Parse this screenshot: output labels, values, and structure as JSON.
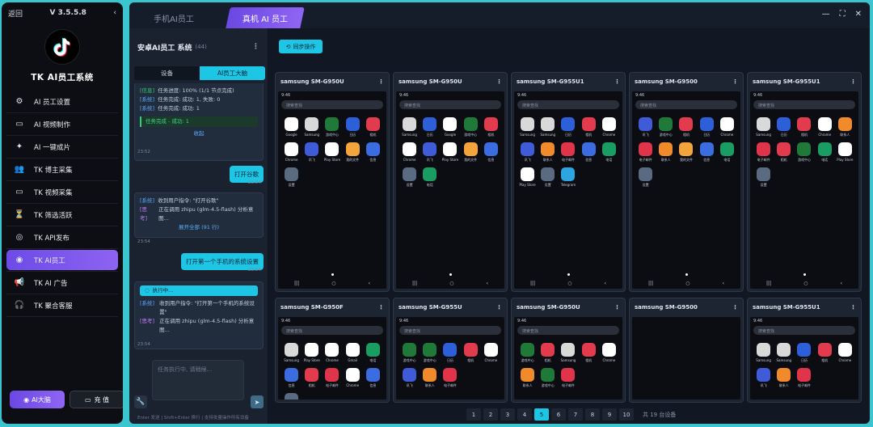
{
  "sidebar": {
    "back": "返回",
    "version": "V 3.5.5.8",
    "title": "TK AI员工系统",
    "menu": [
      "AI 员工设置",
      "AI 视频制作",
      "AI 一键成片",
      "TK 博主采集",
      "TK 视频采集",
      "TK 筛选活跃",
      "TK API发布",
      "TK AI员工",
      "TK AI 广告",
      "TK 聚合客服"
    ],
    "active_index": 7,
    "btn_ai": "AI大脑",
    "btn_charge": "充 值"
  },
  "tabs": [
    "手机AI员工",
    "真机 AI 员工"
  ],
  "chat": {
    "title": "安卓AI员工 系统",
    "count": "(44)",
    "seg": [
      "设备",
      "AI员工大脑"
    ],
    "m1": {
      "l1_tag": "[信息]",
      "l1": "任务进度: 100% (1/1 节点完成)",
      "l2_tag": "[系统]",
      "l2": "任务完成: 成功: 1, 失败: 0",
      "l3_tag": "[系统]",
      "l3": "任务完成: 成功: 1",
      "done": "任务完成 - 成功: 1",
      "fold": "收起",
      "time": "23:52"
    },
    "u1": {
      "text": "打开谷歌",
      "time": "23:54"
    },
    "m2": {
      "l1_tag": "[系统]",
      "l1": "收到用户指令: \"打开谷歌\"",
      "l2_tag": "[思考]",
      "l2": "正在调用 zhipu (glm-4.5-flash) 分析意图...",
      "more": "展开全部 (91 行)",
      "time": "23:54"
    },
    "u2": {
      "text": "打开第一个手机的系统设置",
      "time": "23:54"
    },
    "m3": {
      "running": "执行中...",
      "l1_tag": "[系统]",
      "l1": "收到用户指令: \"打开第一个手机的系统设置\"",
      "l2_tag": "[思考]",
      "l2": "正在调用 zhipu (glm-4.5-flash) 分析意图...",
      "time": "23:54"
    },
    "input_placeholder": "任务执行中, 请稍候...",
    "hint": "Enter 发送 | Shift+Enter 换行 | 支持批量操作所有设备"
  },
  "sync_label": "同步操作",
  "devices": [
    "samsung SM-G950U",
    "samsung SM-G950U",
    "samsung SM-G955U1",
    "samsung SM-G9500",
    "samsung SM-G955U1",
    "samsung SM-G950F",
    "samsung SM-G955U",
    "samsung SM-G950U",
    "samsung SM-G9500",
    "samsung SM-G955U1"
  ],
  "search_label": "搜索查找",
  "pager": {
    "pages": [
      "1",
      "2",
      "3",
      "4",
      "5",
      "6",
      "7",
      "8",
      "9",
      "10"
    ],
    "current": "5",
    "info": "共 19 台设备"
  },
  "app_labels": [
    "Google",
    "Samsung",
    "游戏中心",
    "日历",
    "相机",
    "Chrome",
    "讯飞",
    "Play Store",
    "我的文件",
    "信息",
    "设置",
    "电话",
    "Gmail",
    "Telegram",
    "联系人",
    "电子邮件"
  ],
  "colors": {
    "accent": "#1ec6e6",
    "purple": "#7a55ee"
  }
}
